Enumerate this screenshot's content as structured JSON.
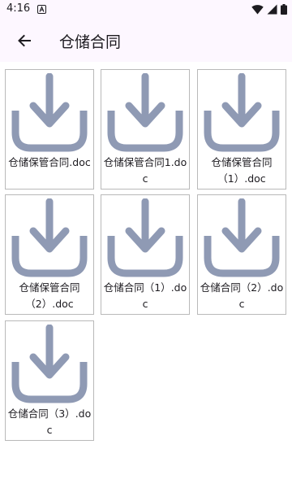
{
  "status_bar": {
    "time": "4:16",
    "notification_icon": "app-a-icon",
    "icons": [
      "wifi-icon",
      "signal-icon",
      "battery-icon"
    ]
  },
  "app_bar": {
    "back_icon": "arrow-left-icon",
    "title": "仓储合同"
  },
  "files": [
    {
      "name": "仓储保管合同.doc",
      "icon": "download-icon"
    },
    {
      "name": "仓储保管合同1.doc",
      "icon": "download-icon"
    },
    {
      "name": "仓储保管合同（1）.doc",
      "icon": "download-icon"
    },
    {
      "name": "仓储保管合同（2）.doc",
      "icon": "download-icon"
    },
    {
      "name": "仓储合同（1）.doc",
      "icon": "download-icon"
    },
    {
      "name": "仓储合同（2）.doc",
      "icon": "download-icon"
    },
    {
      "name": "仓储合同（3）.doc",
      "icon": "download-icon"
    }
  ],
  "colors": {
    "app_bar_bg": "#fdf7ff",
    "icon_fill": "#8f9ab4",
    "tile_border": "#b9b9b9"
  }
}
